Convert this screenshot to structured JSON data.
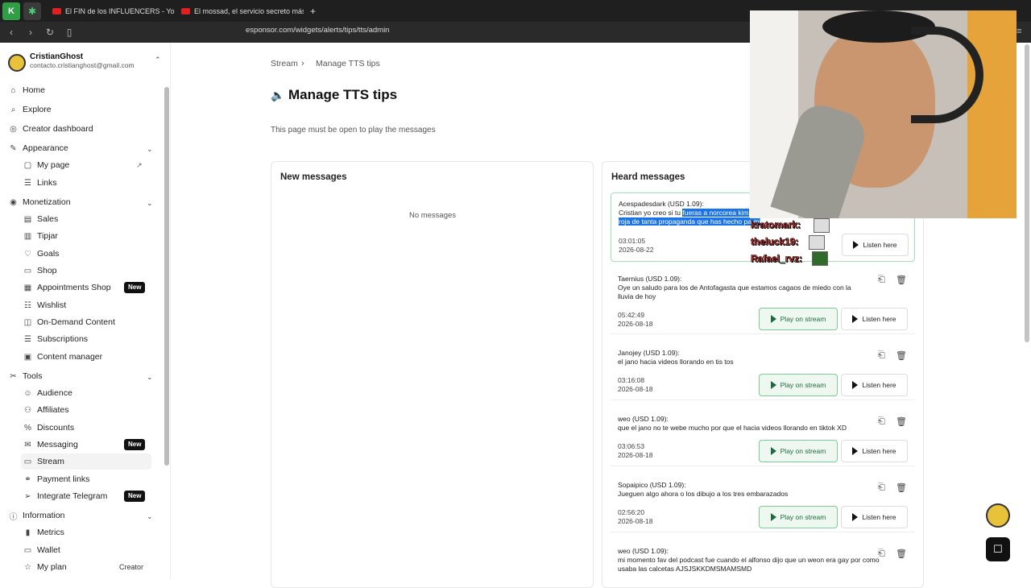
{
  "browser": {
    "tabs": [
      {
        "label": "El FIN de los INFLUENCERS - YouTub"
      },
      {
        "label": "El mossad, el servicio secreto más te"
      }
    ],
    "new_tab": "+",
    "url": "esponsor.com/widgets/alerts/tips/tts/admin"
  },
  "user": {
    "name": "CristianGhost",
    "email": "contacto.cristianghost@gmail.com"
  },
  "sidebar": {
    "home": "Home",
    "explore": "Explore",
    "creator_dashboard": "Creator dashboard",
    "appearance": "Appearance",
    "my_page": "My page",
    "links": "Links",
    "monetization": "Monetization",
    "sales": "Sales",
    "tipjar": "Tipjar",
    "goals": "Goals",
    "shop": "Shop",
    "appointments": "Appointments Shop",
    "wishlist": "Wishlist",
    "on_demand": "On-Demand Content",
    "subscriptions": "Subscriptions",
    "content_manager": "Content manager",
    "tools": "Tools",
    "audience": "Audience",
    "affiliates": "Affiliates",
    "discounts": "Discounts",
    "messaging": "Messaging",
    "stream": "Stream",
    "payment_links": "Payment links",
    "telegram": "Integrate Telegram",
    "information": "Information",
    "metrics": "Metrics",
    "wallet": "Wallet",
    "my_plan": "My plan",
    "plan_name": "Creator",
    "new_badge": "New"
  },
  "breadcrumb": {
    "parent": "Stream",
    "current": "Manage TTS tips"
  },
  "page": {
    "title": "Manage TTS tips",
    "subtitle": "This page must be open to play the messages"
  },
  "new_messages": {
    "title": "New messages",
    "empty": "No messages"
  },
  "heard": {
    "title": "Heard messages",
    "play_label": "Play on stream",
    "listen_label": "Listen here",
    "items": [
      {
        "author": "Acespadesdark (USD 1.09):",
        "text_a": "Cristian yo creo si tu ",
        "text_b": "fueras a norcorea kim",
        "text_c": "roja de tanta propaganda que has hecho pa mi",
        "time": "03:01:05",
        "date": "2026-08-22"
      },
      {
        "author": "Taernius (USD 1.09):",
        "text": "Oye un saludo para los de Antofagasta que estamos cagaos de miedo con la lluvia de hoy",
        "time": "05:42:49",
        "date": "2026-08-18"
      },
      {
        "author": "Janojey (USD 1.09):",
        "text": "el jano hacia videos llorando en tis tos",
        "time": "03:16:08",
        "date": "2026-08-18"
      },
      {
        "author": "weo (USD 1.09):",
        "text": "que el jano no te webe mucho por que el hacia videos llorando en tiktok XD",
        "time": "03:06:53",
        "date": "2026-08-18"
      },
      {
        "author": "Sopaipico (USD 1.09):",
        "text": "Jueguen algo ahora o los dibujo a los tres embarazados",
        "time": "02:56:20",
        "date": "2026-08-18"
      },
      {
        "author": "weo (USD 1.09):",
        "text": "mi momento fav del podcast fue cuando el alfonso dijo que un weon era gay por como usaba las calcetas AJSJSKKDMSMAMSMD",
        "time": "",
        "date": ""
      }
    ]
  },
  "chat": [
    "kratomark:",
    "theluck19:",
    "Rafael_rvz:"
  ],
  "colors": {
    "accent": "#1d6b3a",
    "badge": "#111111",
    "highlight": "#1a73e8"
  }
}
